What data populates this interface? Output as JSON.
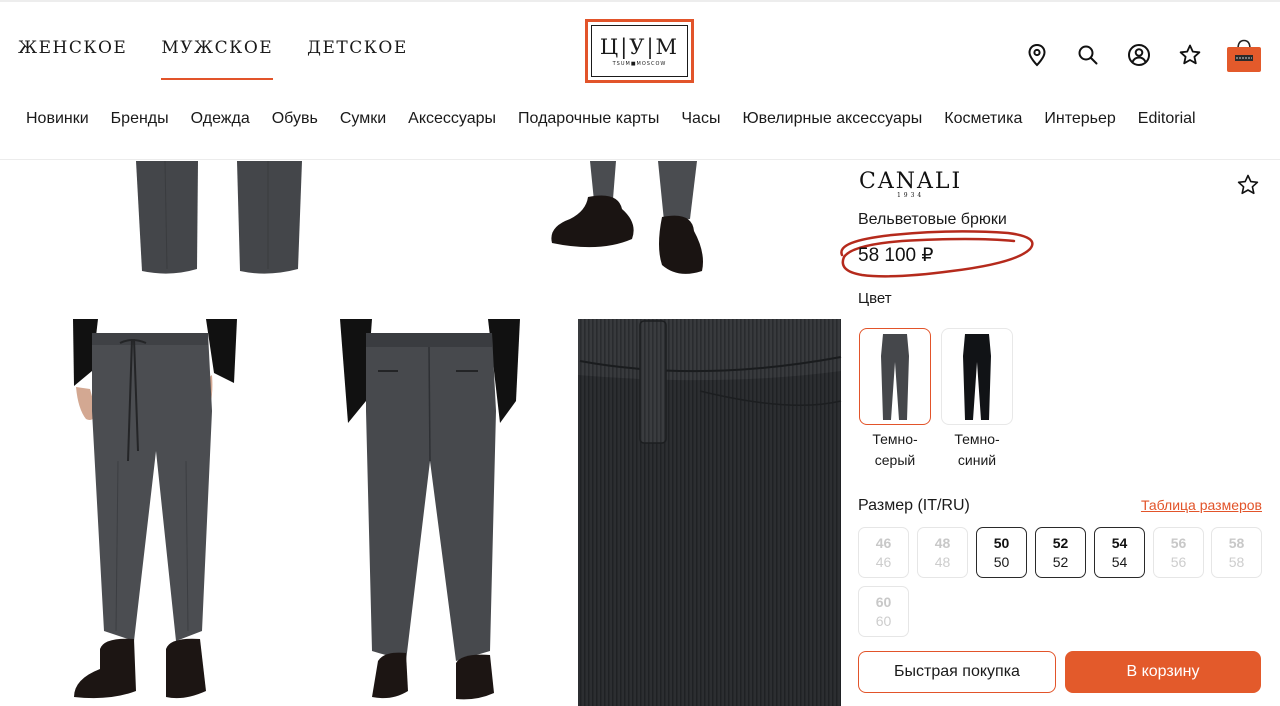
{
  "header": {
    "gender_nav": [
      {
        "label": "ЖЕНСКОЕ",
        "active": false
      },
      {
        "label": "МУЖСКОЕ",
        "active": true
      },
      {
        "label": "ДЕТСКОЕ",
        "active": false
      }
    ],
    "logo": {
      "text": "ЦУМ",
      "sub": "TSUM MOSCOW"
    },
    "icons": [
      "location-pin-icon",
      "search-icon",
      "profile-icon",
      "favorites-star-icon",
      "shopping-bag-icon"
    ],
    "accent_color": "#e2542a"
  },
  "categories": [
    "Новинки",
    "Бренды",
    "Одежда",
    "Обувь",
    "Сумки",
    "Аксессуары",
    "Подарочные карты",
    "Часы",
    "Ювелирные аксессуары",
    "Косметика",
    "Интерьер",
    "Editorial"
  ],
  "product": {
    "brand": "CANALI",
    "brand_year": "1934",
    "name": "Вельветовые брюки",
    "price": "58 100 ₽",
    "color_label": "Цвет",
    "colors": [
      {
        "name": "Темно-\nсерый",
        "line1": "Темно-",
        "line2": "серый",
        "hex": "#3d3f42",
        "selected": true
      },
      {
        "name": "Темно-\nсиний",
        "line1": "Темно-",
        "line2": "синий",
        "hex": "#101216",
        "selected": false
      }
    ],
    "size_label": "Размер (IT/RU)",
    "size_table_link": "Таблица размеров",
    "sizes": [
      {
        "it": "46",
        "ru": "46",
        "available": false
      },
      {
        "it": "48",
        "ru": "48",
        "available": false
      },
      {
        "it": "50",
        "ru": "50",
        "available": true
      },
      {
        "it": "52",
        "ru": "52",
        "available": true
      },
      {
        "it": "54",
        "ru": "54",
        "available": true
      },
      {
        "it": "56",
        "ru": "56",
        "available": false
      },
      {
        "it": "58",
        "ru": "58",
        "available": false
      },
      {
        "it": "60",
        "ru": "60",
        "available": false
      }
    ],
    "quick_buy_label": "Быстрая покупка",
    "add_to_cart_label": "В корзину"
  }
}
